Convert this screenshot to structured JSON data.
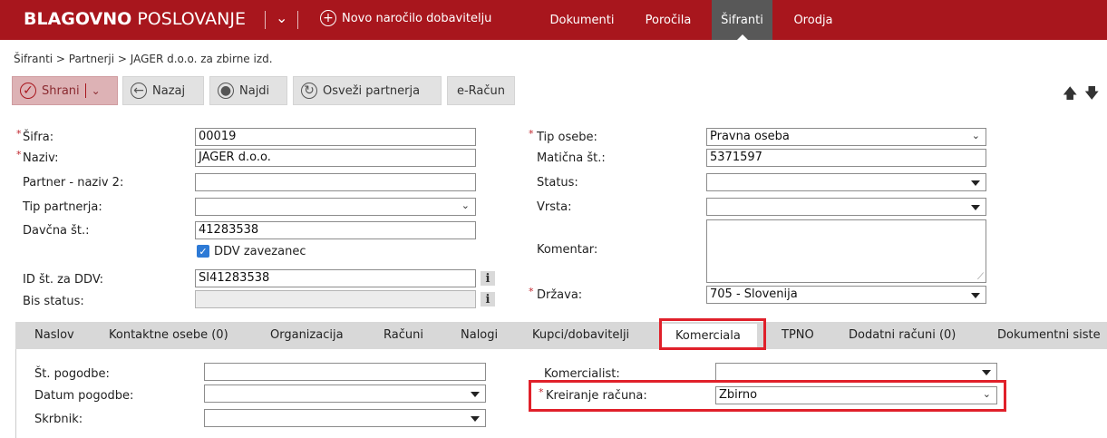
{
  "app": {
    "brand_bold": "BLAGOVNO",
    "brand_light": "POSLOVANJE",
    "new_order": "Novo naročilo dobavitelju",
    "nav": [
      "Dokumenti",
      "Poročila",
      "Šifranti",
      "Orodja"
    ],
    "active_nav": "Šifranti"
  },
  "breadcrumb": "Šifranti > Partnerji > JAGER d.o.o. za zbirne izd.",
  "toolbar": {
    "save": "Shrani",
    "back": "Nazaj",
    "find": "Najdi",
    "refresh": "Osveži partnerja",
    "erac": "e-Račun"
  },
  "form": {
    "sifra_label": "Šifra:",
    "sifra": "00019",
    "naziv_label": "Naziv:",
    "naziv": "JAGER d.o.o.",
    "naziv2_label": "Partner - naziv 2:",
    "naziv2": "",
    "tip_partnerja_label": "Tip partnerja:",
    "tip_partnerja": "",
    "davcna_label": "Davčna št.:",
    "davcna": "41283538",
    "ddv_label": "DDV zavezanec",
    "ddv_checked": true,
    "id_ddv_label": "ID št. za DDV:",
    "id_ddv": "SI41283538",
    "bis_label": "Bis status:",
    "bis": "",
    "tip_osebe_label": "Tip osebe:",
    "tip_osebe": "Pravna oseba",
    "maticna_label": "Matična št.:",
    "maticna": "5371597",
    "status_label": "Status:",
    "status": "",
    "vrsta_label": "Vrsta:",
    "vrsta": "",
    "komentar_label": "Komentar:",
    "komentar": "",
    "drzava_label": "Država:",
    "drzava": "705 - Slovenija"
  },
  "tabs": [
    "Naslov",
    "Kontaktne osebe (0)",
    "Organizacija",
    "Računi",
    "Nalogi",
    "Kupci/dobavitelji",
    "Komerciala",
    "TPNO",
    "Dodatni računi (0)",
    "Dokumentni siste"
  ],
  "active_tab": "Komerciala",
  "commercial": {
    "pogodba_label": "Št. pogodbe:",
    "pogodba": "",
    "datum_label": "Datum pogodbe:",
    "datum": "",
    "skrbnik_label": "Skrbnik:",
    "skrbnik": "",
    "komercialist_label": "Komercialist:",
    "komercialist": "",
    "kreiranje_label": "Kreiranje računa:",
    "kreiranje": "Zbirno"
  },
  "colors": {
    "brand": "#a8161d",
    "highlight": "#e0202a",
    "checkbox": "#2d7ad6"
  }
}
